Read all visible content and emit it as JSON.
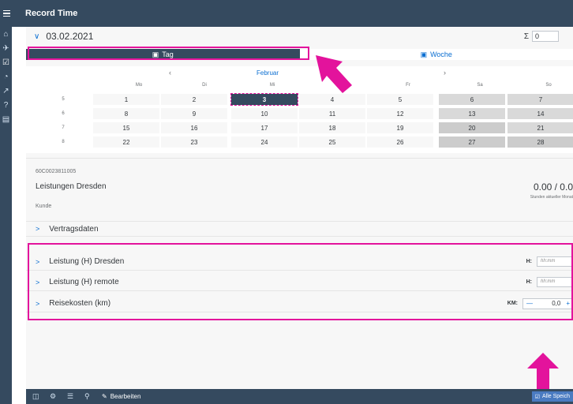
{
  "app": {
    "title": "Record Time"
  },
  "rail": {
    "icons": [
      "home-icon",
      "run-icon",
      "check-icon",
      "clock-icon",
      "chart-icon",
      "help-icon",
      "doc-icon"
    ]
  },
  "header": {
    "date": "03.02.2021",
    "sum_symbol": "Σ",
    "sum_value": "0"
  },
  "tabs": [
    {
      "label": "Tag",
      "icon": "calendar-icon"
    },
    {
      "label": "Woche",
      "icon": "calendar-icon"
    }
  ],
  "calendar": {
    "month": "Februar",
    "weekdays": [
      "Mo",
      "Di",
      "Mi",
      "Do",
      "Fr",
      "Sa",
      "So"
    ],
    "weeks": [
      {
        "week": "5",
        "days": [
          "1",
          "2",
          "3",
          "4",
          "5",
          "6",
          "7"
        ]
      },
      {
        "week": "6",
        "days": [
          "8",
          "9",
          "10",
          "11",
          "12",
          "13",
          "14"
        ]
      },
      {
        "week": "7",
        "days": [
          "15",
          "16",
          "17",
          "18",
          "19",
          "20",
          "21"
        ]
      },
      {
        "week": "8",
        "days": [
          "22",
          "23",
          "24",
          "25",
          "26",
          "27",
          "28"
        ]
      }
    ],
    "selected_day": "3"
  },
  "info": {
    "code": "60C0023811005",
    "name": "Leistungen Dresden",
    "customer_label": "Kunde",
    "hours": "0.00 / 0.0",
    "hours_label": "Stunden aktueller Monat"
  },
  "sections": {
    "vertragsdaten": "Vertragsdaten",
    "leistung_dresden": {
      "label": "Leistung (H) Dresden",
      "field_label": "H:",
      "placeholder": "hh:mm"
    },
    "leistung_remote": {
      "label": "Leistung (H) remote",
      "field_label": "H:",
      "placeholder": "hh:mm"
    },
    "reisekosten": {
      "label": "Reisekosten (km)",
      "field_label": "KM:",
      "value": "0,0"
    }
  },
  "footer": {
    "edit_label": "Bearbeiten",
    "save_all_label": "Alle Speich"
  },
  "colors": {
    "shell": "#354a5f",
    "accent": "#0a6ed1",
    "highlight": "#e3139c"
  }
}
